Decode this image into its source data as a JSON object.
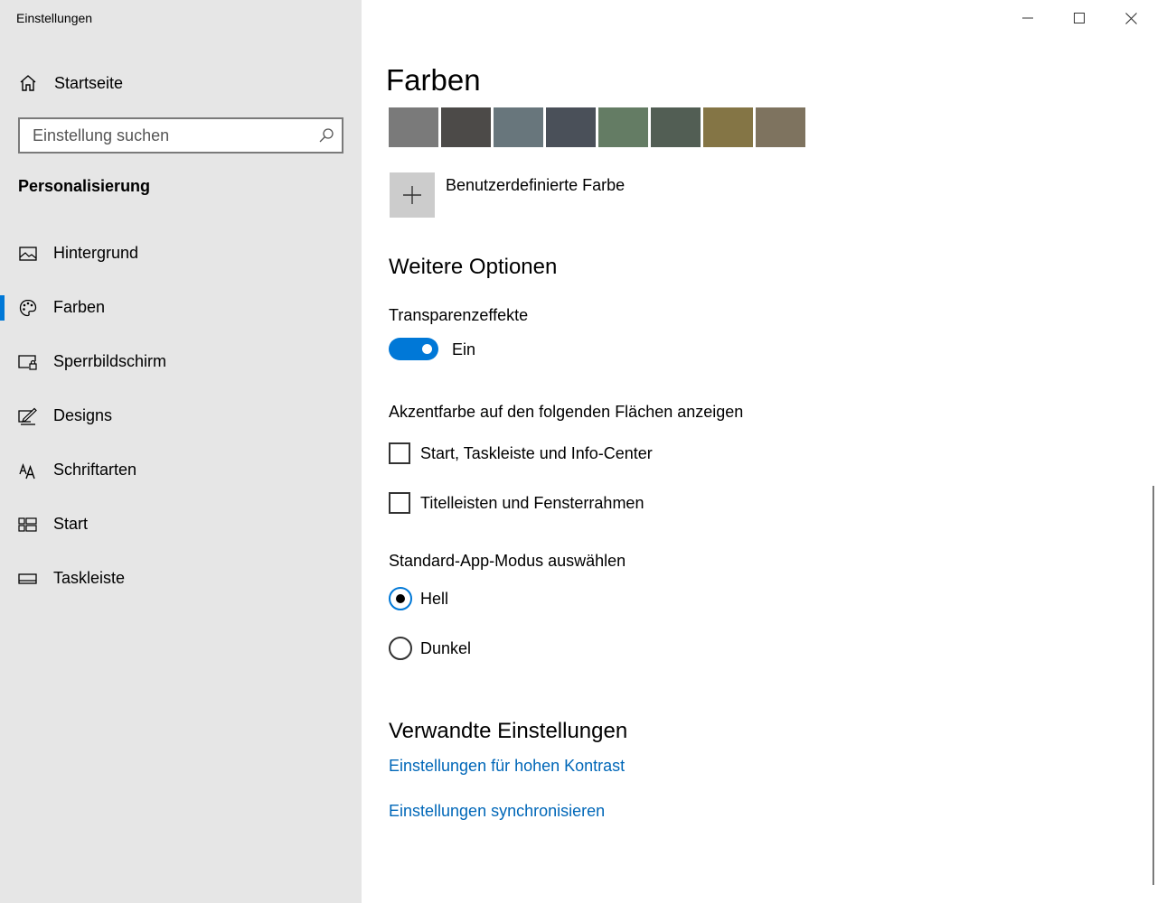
{
  "window": {
    "title": "Einstellungen",
    "controls": [
      "minimize-icon",
      "maximize-icon",
      "close-icon"
    ]
  },
  "sidebar": {
    "home_label": "Startseite",
    "search_placeholder": "Einstellung suchen",
    "section_title": "Personalisierung",
    "items": [
      {
        "label": "Hintergrund",
        "icon": "picture-icon",
        "active": false
      },
      {
        "label": "Farben",
        "icon": "palette-icon",
        "active": true
      },
      {
        "label": "Sperrbildschirm",
        "icon": "lock-screen-icon",
        "active": false
      },
      {
        "label": "Designs",
        "icon": "designs-icon",
        "active": false
      },
      {
        "label": "Schriftarten",
        "icon": "fonts-icon",
        "active": false
      },
      {
        "label": "Start",
        "icon": "start-icon",
        "active": false
      },
      {
        "label": "Taskleiste",
        "icon": "taskbar-icon",
        "active": false
      }
    ],
    "accent_color": "#0078d7"
  },
  "main": {
    "page_title": "Farben",
    "swatches": [
      "#7a7a7a",
      "#4c4a48",
      "#68767c",
      "#4a5059",
      "#647c64",
      "#525e54",
      "#847545",
      "#7e735f"
    ],
    "custom_color_label": "Benutzerdefinierte Farbe",
    "more_options_title": "Weitere Optionen",
    "transparency": {
      "label": "Transparenzeffekte",
      "state_label": "Ein",
      "on": true
    },
    "accent_surfaces": {
      "label": "Akzentfarbe auf den folgenden Flächen anzeigen",
      "options": [
        {
          "label": "Start, Taskleiste und Info-Center",
          "checked": false
        },
        {
          "label": "Titelleisten und Fensterrahmen",
          "checked": false
        }
      ]
    },
    "app_mode": {
      "label": "Standard-App-Modus auswählen",
      "options": [
        {
          "label": "Hell",
          "selected": true
        },
        {
          "label": "Dunkel",
          "selected": false
        }
      ]
    },
    "related": {
      "title": "Verwandte Einstellungen",
      "links": [
        "Einstellungen für hohen Kontrast",
        "Einstellungen synchronisieren"
      ]
    },
    "link_color": "#0067b8"
  }
}
